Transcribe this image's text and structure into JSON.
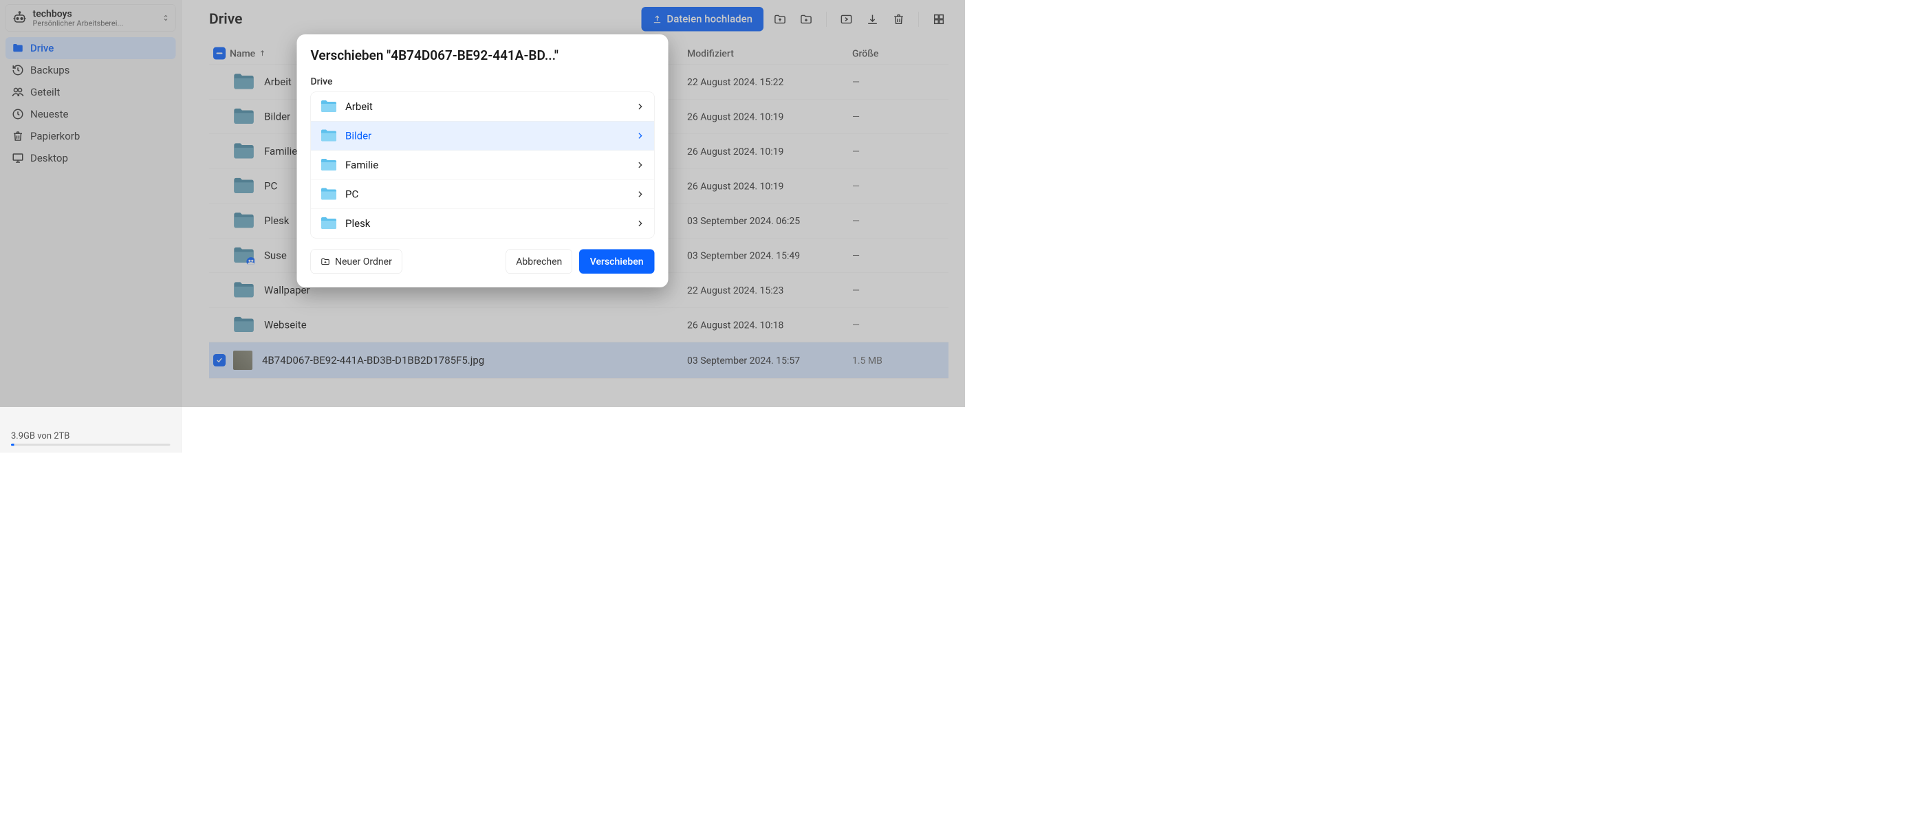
{
  "workspace": {
    "name": "techboys",
    "subtitle": "Persönlicher Arbeitsberei..."
  },
  "sidebar": {
    "items": [
      {
        "label": "Drive",
        "icon": "folder",
        "active": true
      },
      {
        "label": "Backups",
        "icon": "history",
        "active": false
      },
      {
        "label": "Geteilt",
        "icon": "people",
        "active": false
      },
      {
        "label": "Neueste",
        "icon": "clock",
        "active": false
      },
      {
        "label": "Papierkorb",
        "icon": "trash",
        "active": false
      },
      {
        "label": "Desktop",
        "icon": "desktop",
        "active": false
      }
    ]
  },
  "storage": {
    "text": "3.9GB von 2TB"
  },
  "header": {
    "title": "Drive",
    "upload_button": "Dateien hochladen"
  },
  "table": {
    "columns": {
      "name": "Name",
      "modified": "Modifiziert",
      "size": "Größe"
    },
    "rows": [
      {
        "type": "folder",
        "name": "Arbeit",
        "modified": "22 August 2024. 15:22",
        "size": "—",
        "shared": false
      },
      {
        "type": "folder",
        "name": "Bilder",
        "modified": "26 August 2024. 10:19",
        "size": "—",
        "shared": false
      },
      {
        "type": "folder",
        "name": "Familie",
        "modified": "26 August 2024. 10:19",
        "size": "—",
        "shared": false
      },
      {
        "type": "folder",
        "name": "PC",
        "modified": "26 August 2024. 10:19",
        "size": "—",
        "shared": false
      },
      {
        "type": "folder",
        "name": "Plesk",
        "modified": "03 September 2024. 06:25",
        "size": "—",
        "shared": false
      },
      {
        "type": "folder",
        "name": "Suse",
        "modified": "03 September 2024. 15:49",
        "size": "—",
        "shared": true
      },
      {
        "type": "folder",
        "name": "Wallpaper",
        "modified": "22 August 2024. 15:23",
        "size": "—",
        "shared": false
      },
      {
        "type": "folder",
        "name": "Webseite",
        "modified": "26 August 2024. 10:18",
        "size": "—",
        "shared": false
      },
      {
        "type": "file",
        "name": "4B74D067-BE92-441A-BD3B-D1BB2D1785F5.jpg",
        "modified": "03 September 2024. 15:57",
        "size": "1.5 MB",
        "selected": true
      }
    ]
  },
  "modal": {
    "title": "Verschieben \"4B74D067-BE92-441A-BD...\"",
    "breadcrumb": "Drive",
    "folders": [
      {
        "name": "Arbeit",
        "highlighted": false
      },
      {
        "name": "Bilder",
        "highlighted": true
      },
      {
        "name": "Familie",
        "highlighted": false
      },
      {
        "name": "PC",
        "highlighted": false
      },
      {
        "name": "Plesk",
        "highlighted": false
      }
    ],
    "new_folder": "Neuer Ordner",
    "cancel": "Abbrechen",
    "move": "Verschieben"
  }
}
